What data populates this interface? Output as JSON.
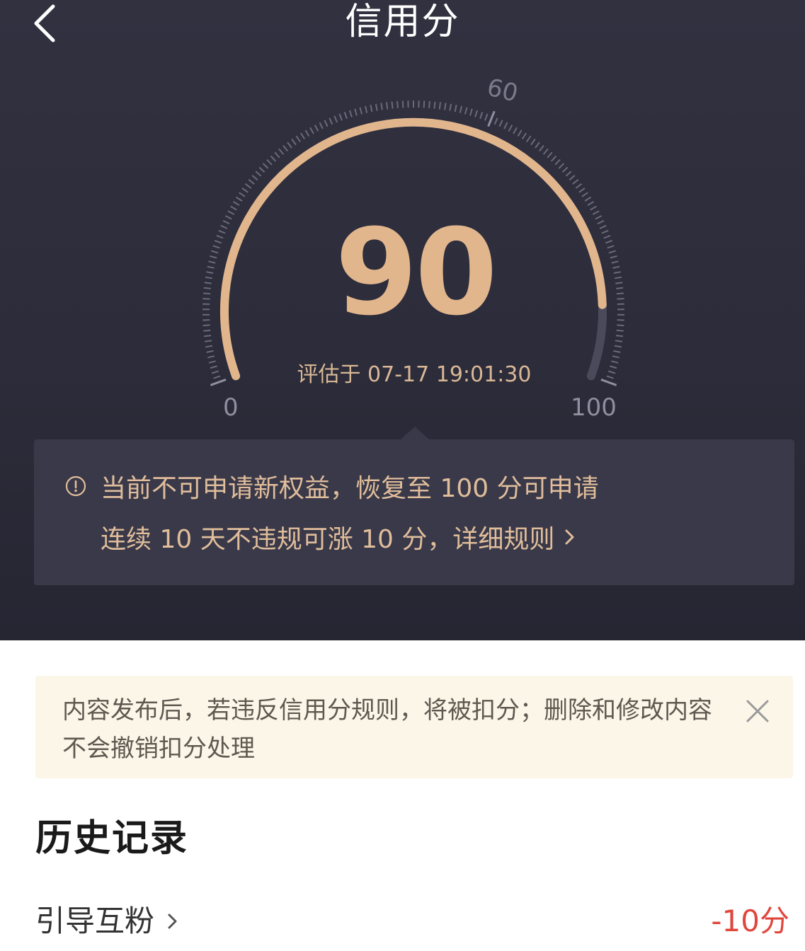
{
  "header": {
    "title": "信用分",
    "back_icon": "chevron-left-icon"
  },
  "gauge": {
    "score": "90",
    "score_value": 90,
    "min": "0",
    "mid": "60",
    "max": "100",
    "evaluated_at": "评估于 07-17 19:01:30",
    "arc_color": "#e2b68d",
    "track_color": "#4a4a5a"
  },
  "notice": {
    "icon": "alert-circle-icon",
    "line1": "当前不可申请新权益，恢复至 100 分可申请",
    "line2": "连续 10 天不违规可涨 10 分，详细规则",
    "link_icon": "chevron-right-icon"
  },
  "tip": {
    "text": "内容发布后，若违反信用分规则，将被扣分；删除和修改内容不会撤销扣分处理",
    "close_icon": "close-icon"
  },
  "history": {
    "title": "历史记录",
    "items": [
      {
        "label": "引导互粉",
        "value": "-10分"
      }
    ]
  },
  "colors": {
    "accent": "#e2b68d",
    "negative": "#e0473c",
    "tip_bg": "#fcf6e9"
  }
}
